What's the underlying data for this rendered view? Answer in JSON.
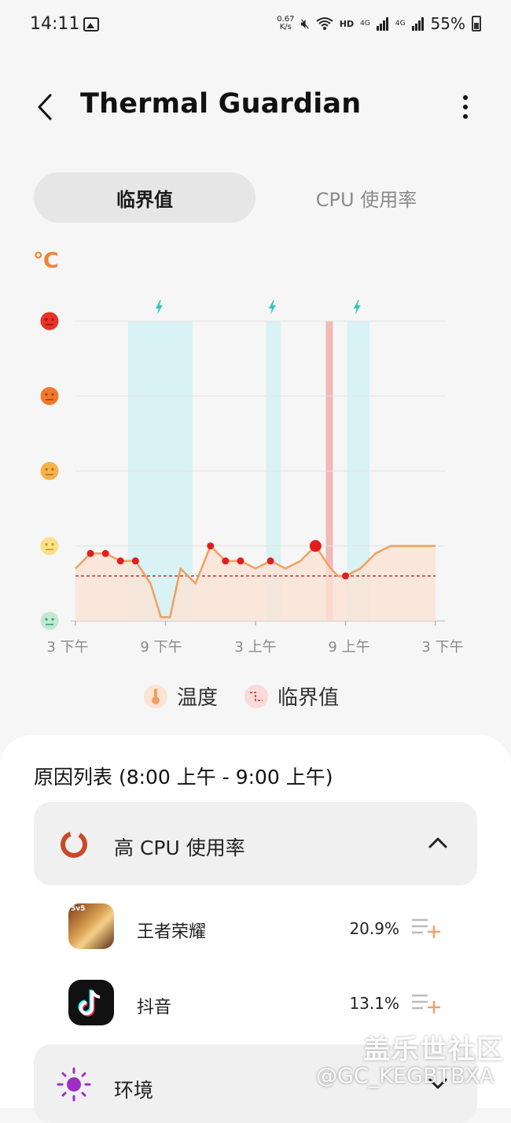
{
  "status": {
    "time": "14:11",
    "net_speed_value": "0.67",
    "net_speed_unit": "K/s",
    "hd": "HD",
    "signal1": "4G",
    "signal2": "4G",
    "battery": "55%"
  },
  "header": {
    "title": "Thermal Guardian"
  },
  "tabs": [
    {
      "label": "临界值",
      "active": true
    },
    {
      "label": "CPU 使用率",
      "active": false
    }
  ],
  "chart": {
    "unit_label": "℃",
    "x_ticks": [
      "3 下午",
      "9 下午",
      "3 上午",
      "9 上午",
      "3 下午"
    ],
    "legend": [
      {
        "label": "温度",
        "color": "#f0a070"
      },
      {
        "label": "临界值",
        "color": "#e07a7a"
      }
    ]
  },
  "chart_data": {
    "type": "area",
    "x_ticks": [
      "3 下午",
      "9 下午",
      "3 上午",
      "9 上午",
      "3 下午"
    ],
    "y_levels": [
      "cool",
      "normal",
      "warm",
      "hot",
      "critical"
    ],
    "series": [
      {
        "name": "温度",
        "x_hours": [
          0,
          1,
          2,
          3,
          4,
          5,
          5.7,
          6.3,
          7,
          8,
          9,
          10,
          11,
          12,
          13,
          14,
          15,
          16,
          17,
          17.5,
          18,
          19,
          20,
          21,
          22,
          23,
          24
        ],
        "y_level": [
          0.7,
          0.9,
          0.9,
          0.8,
          0.8,
          0.5,
          0.05,
          0.05,
          0.7,
          0.5,
          1.0,
          0.8,
          0.8,
          0.7,
          0.8,
          0.7,
          0.8,
          1.0,
          0.7,
          0.6,
          0.6,
          0.7,
          0.9,
          1.0,
          1.0,
          1.0,
          1.0
        ],
        "markers": [
          1,
          2,
          3,
          4,
          10,
          11,
          12,
          14,
          17,
          20
        ]
      }
    ],
    "threshold_level": 0.6,
    "charging_ranges_hours": [
      [
        3.5,
        7.8
      ],
      [
        12.7,
        13.7
      ],
      [
        18.1,
        19.6
      ]
    ],
    "highlight_hour": 16.9,
    "selected_index": 17,
    "colors": {
      "line": "#f0a060",
      "fill": "#fbe2d4",
      "marker": "#e01e1e",
      "threshold": "#c03a3a",
      "charging_band": "#d4f1f3",
      "charging_icon": "#2fc7c7",
      "highlight_band": "#f2a9a9"
    }
  },
  "reasons": {
    "title": "原因列表 (8:00 上午 - 9:00 上午)",
    "cpu_group": {
      "label": "高 CPU 使用率",
      "apps": [
        {
          "name": "王者荣耀",
          "percent": "20.9%"
        },
        {
          "name": "抖音",
          "percent": "13.1%"
        }
      ]
    },
    "env_group": {
      "label": "环境"
    }
  },
  "watermark": {
    "line1": "盖乐世社区",
    "line2": "@GC_KEGBTBXA"
  }
}
